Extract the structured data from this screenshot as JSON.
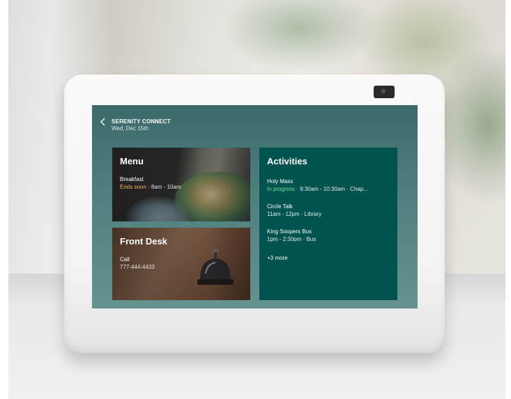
{
  "header": {
    "title": "SERENITY CONNECT",
    "date": "Wed, Dec 15th"
  },
  "menu": {
    "title": "Menu",
    "meal": "Breakfast",
    "status": "Ends soon",
    "time": " · 8am - 10am"
  },
  "front_desk": {
    "title": "Front Desk",
    "action": "Call",
    "phone": "777-444-4433"
  },
  "activities": {
    "title": "Activities",
    "items": [
      {
        "name": "Holy Mass",
        "status": "In progress",
        "detail": " · 9:30am - 10:30am · Chap..."
      },
      {
        "name": "Circle Talk",
        "detail": "11am - 12pm · Library"
      },
      {
        "name": "King Soopers Bus",
        "detail": "1pm - 2:30pm · Bus"
      }
    ],
    "more": "+3 more"
  },
  "colors": {
    "activities_bg": "#00534f",
    "in_progress": "#6fdc9a",
    "ends_soon": "#f2b35c"
  }
}
